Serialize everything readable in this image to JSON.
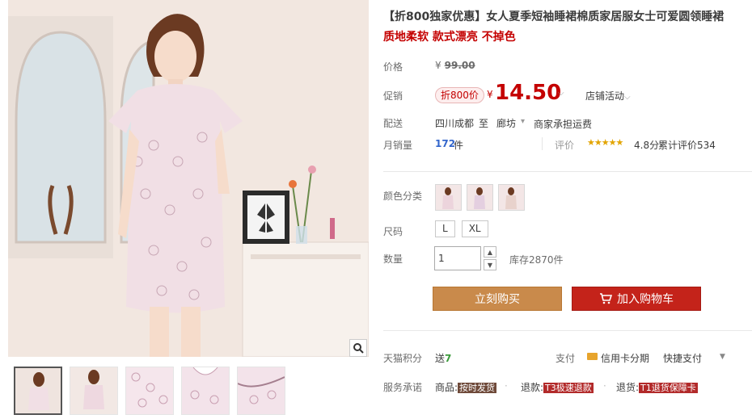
{
  "product": {
    "title": "【折800独家优惠】女人夏季短袖睡裙棉质家居服女士可爱圆领睡裙",
    "subtitle": "质地柔软 款式漂亮 不掉色"
  },
  "price": {
    "label": "价格",
    "currency": "¥",
    "original": "99.00"
  },
  "promo": {
    "label": "促销",
    "tag": "折800价",
    "currency": "¥",
    "price": "14.50",
    "store_activity": "店铺活动"
  },
  "shipping": {
    "label": "配送",
    "from": "四川成都",
    "to": "至",
    "city": "廊坊",
    "fee": "商家承担运费"
  },
  "sales": {
    "label": "月销量",
    "count": "172",
    "unit": "件",
    "rating_label": "评价",
    "stars": "★★★★★",
    "score": "4.8分",
    "total_reviews": "累计评价534"
  },
  "options": {
    "color_label": "颜色分类",
    "size_label": "尺码",
    "sizes": [
      "L",
      "XL"
    ],
    "qty_label": "数量",
    "qty_value": "1",
    "stock": "库存2870件"
  },
  "actions": {
    "buy_now": "立刻购买",
    "add_to_cart": "加入购物车"
  },
  "points": {
    "label": "天猫积分",
    "value_prefix": "送",
    "value": "7"
  },
  "payment": {
    "label": "支付",
    "card": "信用卡分期",
    "quick": "快捷支付"
  },
  "service": {
    "label": "服务承诺",
    "goods_prefix": "商品:",
    "goods_tag": "按时发货",
    "refund_prefix": "退款:",
    "refund_tag": "T3极速退款",
    "return_prefix": "退货:",
    "return_tag": "T1退货保障卡"
  },
  "colors": {
    "accent_red": "#c40000",
    "buy_now": "#c98a4b",
    "add_cart": "#c4231a",
    "link_blue": "#3366cc"
  },
  "icons": [
    "zoom-icon",
    "cart-icon",
    "chevron-down-icon",
    "star-icon",
    "credit-card-icon"
  ]
}
